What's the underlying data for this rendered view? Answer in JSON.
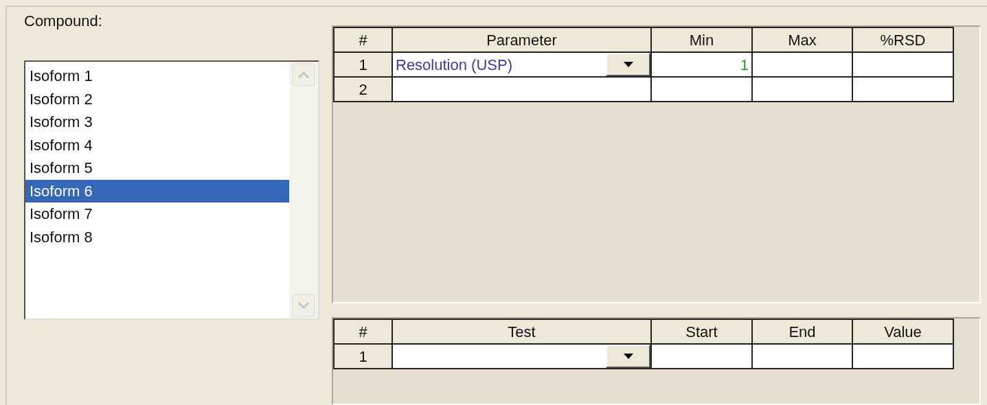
{
  "compound": {
    "label": "Compound:",
    "items": [
      {
        "label": "Isoform 1",
        "selected": false
      },
      {
        "label": "Isoform 2",
        "selected": false
      },
      {
        "label": "Isoform 3",
        "selected": false
      },
      {
        "label": "Isoform 4",
        "selected": false
      },
      {
        "label": "Isoform 5",
        "selected": false
      },
      {
        "label": "Isoform 6",
        "selected": true
      },
      {
        "label": "Isoform 7",
        "selected": false
      },
      {
        "label": "Isoform 8",
        "selected": false
      }
    ]
  },
  "parameters_table": {
    "columns": [
      "#",
      "Parameter",
      "Min",
      "Max",
      "%RSD"
    ],
    "rows": [
      {
        "number": "1",
        "parameter": "Resolution (USP)",
        "dropdown": true,
        "min": "1"
      },
      {
        "number": "2",
        "dropdown": false
      }
    ]
  },
  "tests_table": {
    "columns": [
      "#",
      "Test",
      "Start",
      "End",
      "Value"
    ],
    "rows": [
      {
        "number": "1",
        "dropdown": true
      }
    ]
  }
}
